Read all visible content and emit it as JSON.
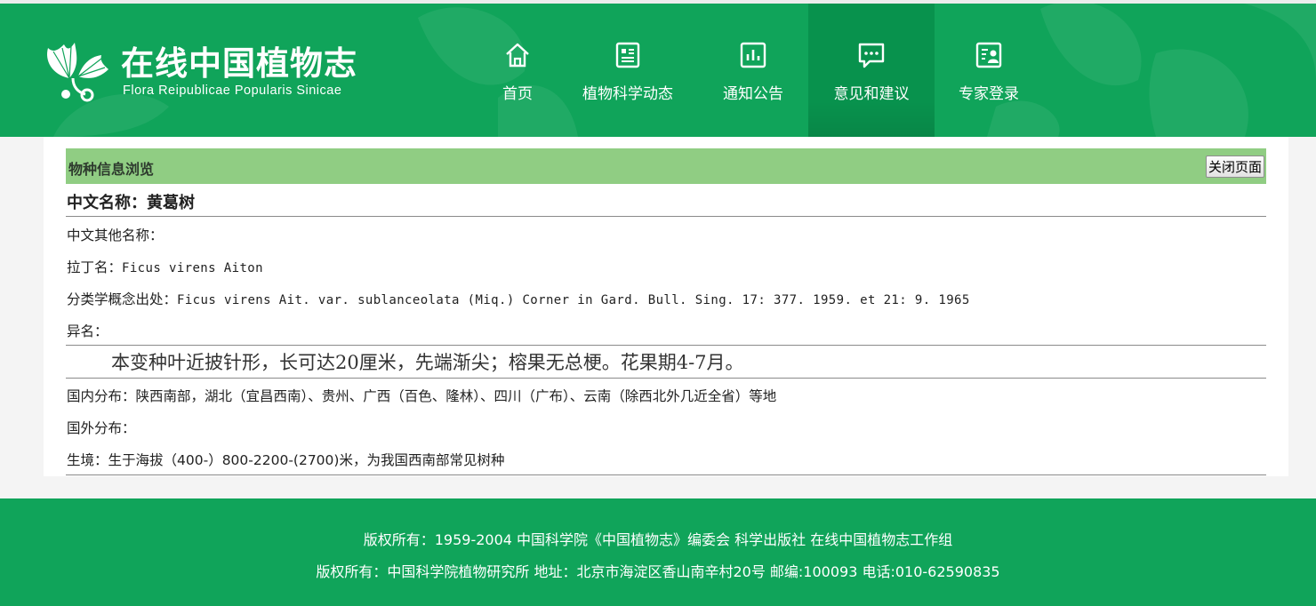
{
  "header": {
    "title": "在线中国植物志",
    "subtitle": "Flora Reipublicae Popularis Sinicae",
    "logo_icon": "ginkgo-leaf-icon",
    "nav": [
      {
        "label": "首页",
        "icon": "home-icon",
        "active": false
      },
      {
        "label": "植物科学动态",
        "icon": "news-icon",
        "active": false
      },
      {
        "label": "通知公告",
        "icon": "chart-icon",
        "active": false
      },
      {
        "label": "意见和建议",
        "icon": "chat-bubble-icon",
        "active": true
      },
      {
        "label": "专家登录",
        "icon": "user-card-icon",
        "active": false
      }
    ],
    "colors": {
      "brand_green": "#10a45a",
      "active_tab": "#08924d"
    }
  },
  "panel": {
    "title": "物种信息浏览",
    "close_label": "关闭页面",
    "head_color": "#90cd83"
  },
  "species": {
    "chinese_name_label": "中文名称：",
    "chinese_name": "黄葛树",
    "other_names_label": "中文其他名称：",
    "other_names": "",
    "latin_label": "拉丁名：",
    "latin": "Ficus virens Aiton",
    "taxon_source_label": "分类学概念出处：",
    "taxon_source": "Ficus virens Ait. var. sublanceolata (Miq.) Corner in Gard. Bull. Sing. 17: 377. 1959. et 21: 9. 1965",
    "synonyms_label": "异名：",
    "synonyms": "",
    "description": "本变种叶近披针形，长可达20厘米，先端渐尖；榕果无总梗。花果期4-7月。",
    "domestic_label": "国内分布：",
    "domestic": "陕西南部，湖北（宜昌西南）、贵州、广西（百色、隆林）、四川（广布）、云南（除西北外几近全省）等地",
    "foreign_label": "国外分布：",
    "foreign": "",
    "habitat_label": "生境：",
    "habitat": "生于海拔（400-）800-2200-(2700)米，为我国西南部常见树种"
  },
  "footer": {
    "line1": "版权所有：1959-2004 中国科学院《中国植物志》编委会 科学出版社  在线中国植物志工作组",
    "line2": "版权所有：中国科学院植物研究所 地址：北京市海淀区香山南辛村20号 邮编:100093 电话:010-62590835"
  }
}
